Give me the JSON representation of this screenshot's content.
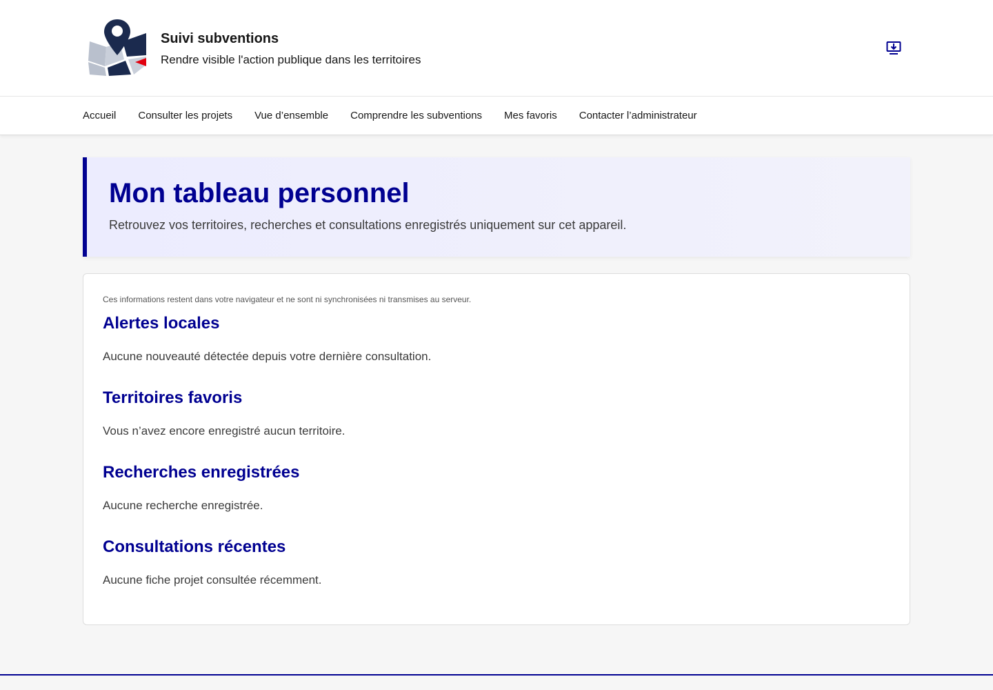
{
  "header": {
    "title": "Suivi subventions",
    "tagline": "Rendre visible l'action publique dans les territoires",
    "logo_icon": "map-pin-logo-icon",
    "install_icon": "install-download-icon"
  },
  "nav": {
    "items": [
      {
        "label": "Accueil"
      },
      {
        "label": "Consulter les projets"
      },
      {
        "label": "Vue d’ensemble"
      },
      {
        "label": "Comprendre les subventions"
      },
      {
        "label": "Mes favoris"
      },
      {
        "label": "Contacter l’administrateur"
      }
    ]
  },
  "hero": {
    "title": "Mon tableau personnel",
    "subtitle": "Retrouvez vos territoires, recherches et consultations enregistrés uniquement sur cet appareil."
  },
  "card": {
    "notice": "Ces informations restent dans votre navigateur et ne sont ni synchronisées ni transmises au serveur.",
    "sections": [
      {
        "title": "Alertes locales",
        "text": "Aucune nouveauté détectée depuis votre dernière consultation."
      },
      {
        "title": "Territoires favoris",
        "text": "Vous n’avez encore enregistré aucun territoire."
      },
      {
        "title": "Recherches enregistrées",
        "text": "Aucune recherche enregistrée."
      },
      {
        "title": "Consultations récentes",
        "text": "Aucune fiche projet consultée récemment."
      }
    ]
  },
  "colors": {
    "primary": "#000091",
    "accent_red": "#e1000f",
    "logo_grey": "#b9c0cd",
    "logo_navy": "#1b2a4e"
  }
}
